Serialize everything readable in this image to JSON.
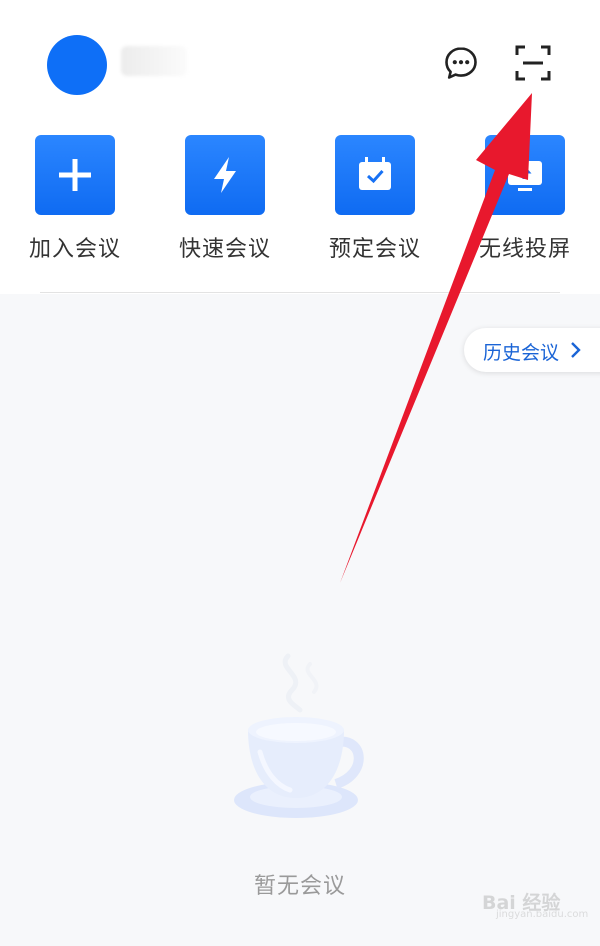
{
  "header": {
    "avatar_color": "#0e6ff7",
    "icons": [
      "chat-bubble-icon",
      "scan-icon"
    ]
  },
  "actions": [
    {
      "label": "加入会议",
      "icon": "plus-icon"
    },
    {
      "label": "快速会议",
      "icon": "lightning-icon"
    },
    {
      "label": "预定会议",
      "icon": "calendar-check-icon"
    },
    {
      "label": "无线投屏",
      "icon": "screen-cast-icon"
    }
  ],
  "history_button": {
    "label": "历史会议",
    "icon": "chevron-right-icon"
  },
  "empty_state": {
    "text": "暂无会议",
    "icon": "coffee-cup-icon"
  },
  "watermark": {
    "text": "Bai 经验",
    "sub": "jingyan.baidu.com"
  },
  "colors": {
    "accent": "#0f6bf2",
    "link": "#1a64d6",
    "annotation_arrow": "#e8182d"
  }
}
